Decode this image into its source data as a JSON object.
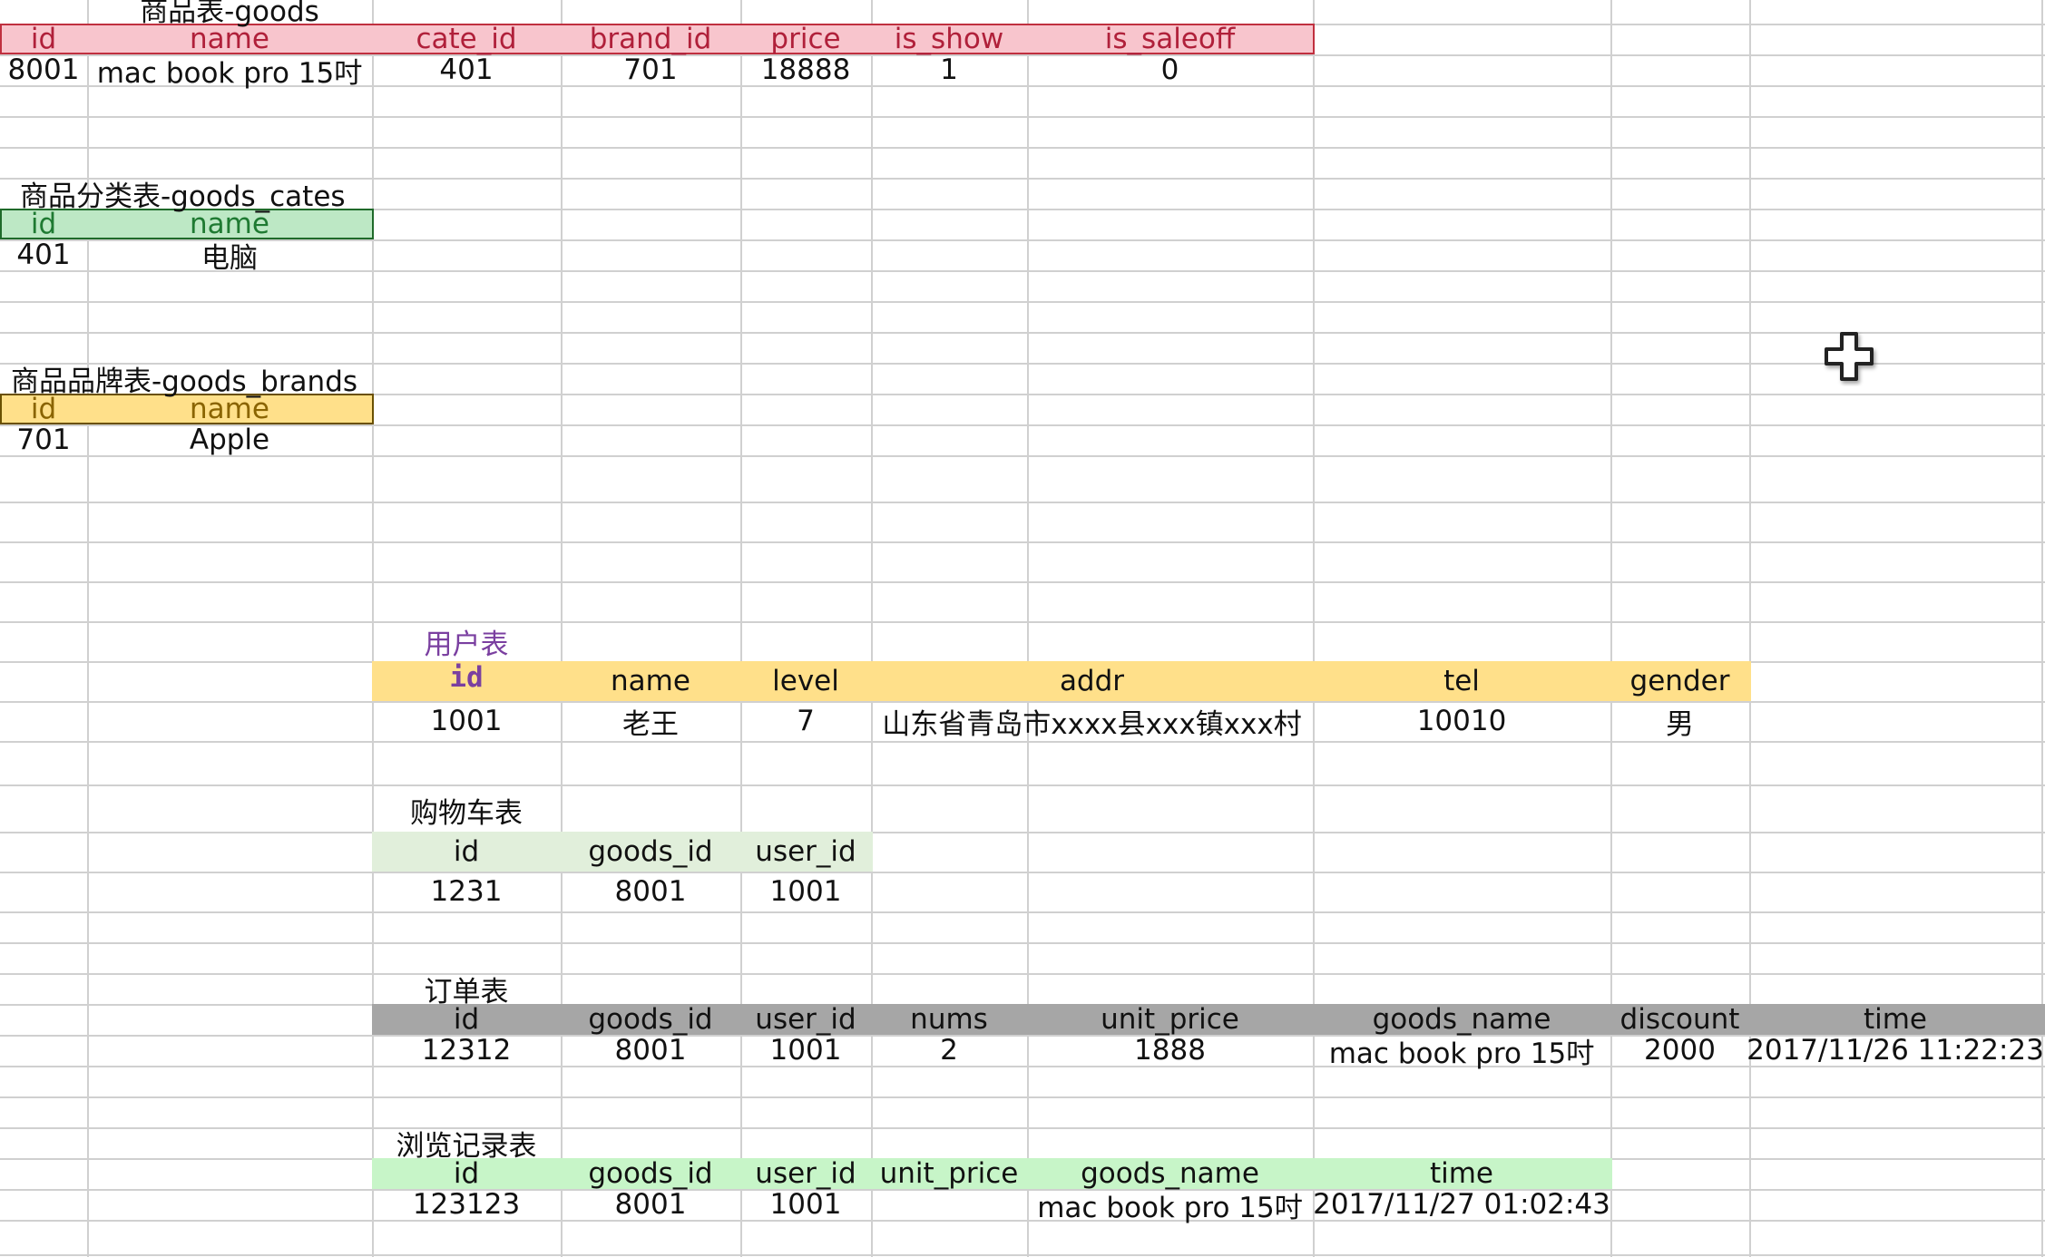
{
  "colors": {
    "grid": "#d0d0d0",
    "pink_header": "#f8c5cd",
    "pink_text": "#b0203a",
    "green_header": "#bde8c5",
    "green_text": "#1f7a32",
    "yellow_header": "#ffe08a",
    "yellow_text": "#8a6400",
    "user_title": "#7a3fa0",
    "pale_green_header": "#e1efdb",
    "gray_header": "#a6a6a6",
    "mint_header": "#c7f5c8"
  },
  "cursor_icon": "move-cross-icon",
  "tables": {
    "goods": {
      "title": "商品表-goods",
      "headers": [
        "id",
        "name",
        "cate_id",
        "brand_id",
        "price",
        "is_show",
        "is_saleoff"
      ],
      "rows": [
        [
          "8001",
          "mac book pro 15吋",
          "401",
          "701",
          "18888",
          "1",
          "0"
        ]
      ]
    },
    "goods_cates": {
      "title": "商品分类表-goods_cates",
      "headers": [
        "id",
        "name"
      ],
      "rows": [
        [
          "401",
          "电脑"
        ]
      ]
    },
    "goods_brands": {
      "title": "商品品牌表-goods_brands",
      "headers": [
        "id",
        "name"
      ],
      "rows": [
        [
          "701",
          "Apple"
        ]
      ]
    },
    "users": {
      "title": "用户表",
      "headers": [
        "id",
        "name",
        "level",
        "addr",
        "tel",
        "gender"
      ],
      "rows": [
        [
          "1001",
          "老王",
          "7",
          "山东省青岛市xxxx县xxx镇xxx村",
          "10010",
          "男"
        ]
      ]
    },
    "cart": {
      "title": "购物车表",
      "headers": [
        "id",
        "goods_id",
        "user_id"
      ],
      "rows": [
        [
          "1231",
          "8001",
          "1001"
        ]
      ]
    },
    "orders": {
      "title": "订单表",
      "headers": [
        "id",
        "goods_id",
        "user_id",
        "nums",
        "unit_price",
        "goods_name",
        "discount",
        "time"
      ],
      "rows": [
        [
          "12312",
          "8001",
          "1001",
          "2",
          "1888",
          "mac book pro 15吋",
          "2000",
          "2017/11/26 11:22:23"
        ]
      ]
    },
    "history": {
      "title": "浏览记录表",
      "headers": [
        "id",
        "goods_id",
        "user_id",
        "unit_price",
        "goods_name",
        "time"
      ],
      "rows": [
        [
          "123123",
          "8001",
          "1001",
          "",
          "mac book pro 15吋",
          "2017/11/27  01:02:43"
        ]
      ]
    }
  }
}
